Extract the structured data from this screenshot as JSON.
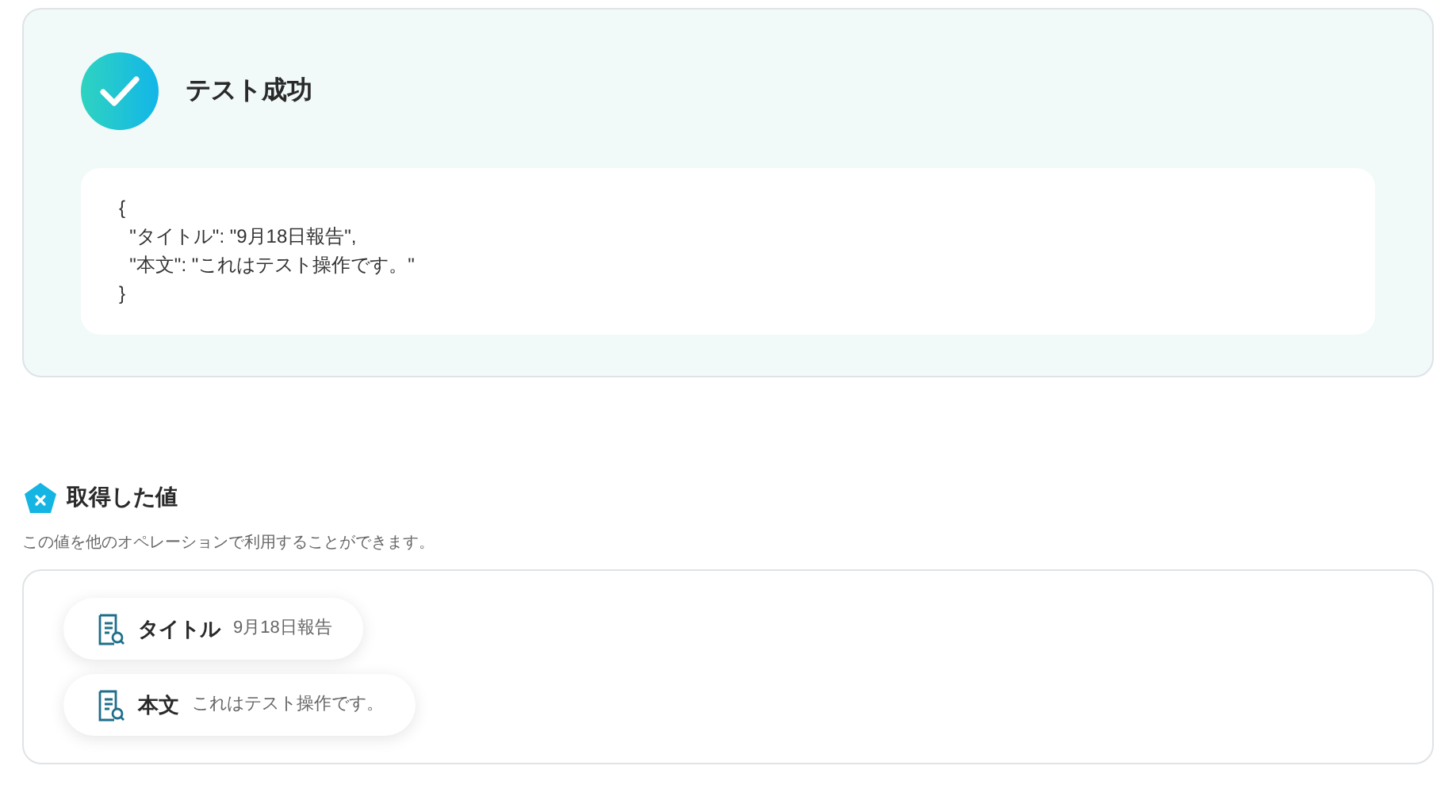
{
  "result": {
    "title": "テスト成功",
    "code_lines": [
      "{",
      "  \"タイトル\": \"9月18日報告\",",
      "  \"本文\": \"これはテスト操作です。\"",
      "}"
    ]
  },
  "values_section": {
    "title": "取得した値",
    "description": "この値を他のオペレーションで利用することができます。",
    "items": [
      {
        "label": "タイトル",
        "value": "9月18日報告"
      },
      {
        "label": "本文",
        "value": "これはテスト操作です。"
      }
    ]
  }
}
